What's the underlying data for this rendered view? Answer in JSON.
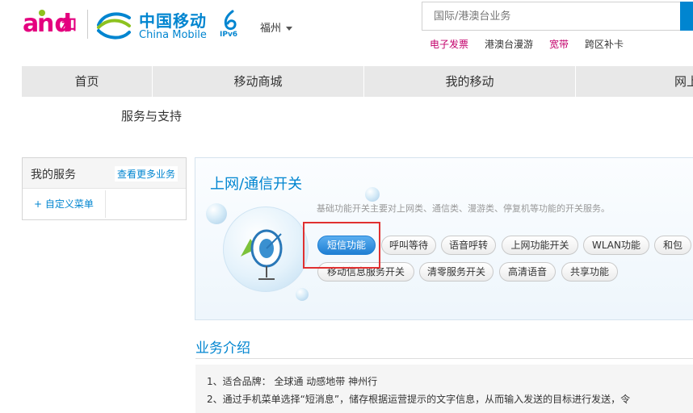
{
  "header": {
    "logo_and_text": "a",
    "logo_and_text2": "nd",
    "logo_he": "和",
    "logo_title": "中国移动",
    "logo_subtitle": "China Mobile",
    "logo_ipv6": "IPv6",
    "city": "福州",
    "search_placeholder": "国际/港澳台业务",
    "quick_links": [
      {
        "label": "电子发票",
        "color": "#c3006b"
      },
      {
        "label": "港澳台漫游",
        "color": "#333333"
      },
      {
        "label": "宽带",
        "color": "#c3006b"
      },
      {
        "label": "跨区补卡",
        "color": "#333333"
      }
    ]
  },
  "nav": {
    "items": [
      "首页",
      "移动商城",
      "我的移动",
      "网上"
    ],
    "sub_item": "服务与支持"
  },
  "left_panel": {
    "title": "我的服务",
    "more_link": "查看更多业务",
    "custom_menu": "+ 自定义菜单"
  },
  "card": {
    "title": "上网/通信开关",
    "description": "基础功能开关主要对上网类、通信类、漫游类、停复机等功能的开关服务。",
    "row1": [
      "短信功能",
      "呼叫等待",
      "语音呼转",
      "上网功能开关",
      "WLAN功能",
      "和包"
    ],
    "row2": [
      "移动信息服务开关",
      "清零服务开关",
      "高清语音",
      "共享功能"
    ]
  },
  "intro": {
    "title": "业务介绍",
    "line1": "1、适合品牌： 全球通 动感地带 神州行",
    "line2": "2、通过手机菜单选择“短消息”，储存根据运营提示的文字信息，从而输入发送的目标进行发送，令"
  },
  "colors": {
    "brand_blue": "#0085d0",
    "brand_pink": "#e4007f",
    "highlight_red": "#e03030"
  }
}
